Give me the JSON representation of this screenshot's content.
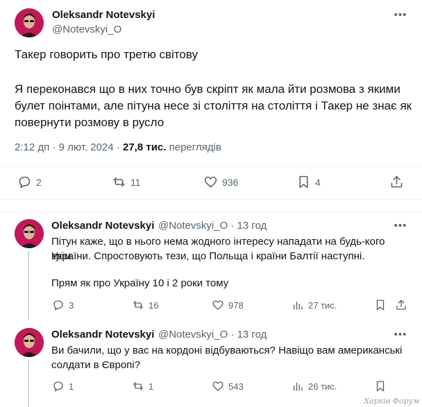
{
  "main_tweet": {
    "author_name": "Oleksandr Notevskyi",
    "author_handle": "@Notevskyi_O",
    "line1": "Такер говорить про третю світову",
    "para2_line1": "Я переконався що в них точно був скріпт як мала йти розмова з якими",
    "para2_line2": "булет поінтами, але пітуна несе зі століття на століття і Такер не знає як",
    "para2_line3": "повернути розмову в русло",
    "time": "2:12 дп · 9 лют. 2024 · ",
    "views_count": "27,8 тис.",
    "views_label": " переглядів",
    "replies": "2",
    "reposts": "11",
    "likes": "936",
    "bookmarks": "4"
  },
  "replies": [
    {
      "author_name": "Oleksandr Notevskyi",
      "author_handle": "@Notevskyi_O · 13 год",
      "line1": "Пітун каже, що в нього нема жодного інтересу нападати на будь-кого крім",
      "line2": "України. Спростовують тези, що Польща і країни Балтії наступні.",
      "line3": "Прям як про Україну 10 і 2 роки тому",
      "replies": "3",
      "reposts": "16",
      "likes": "978",
      "views": "27 тис."
    },
    {
      "author_name": "Oleksandr Notevskyi",
      "author_handle": "@Notevskyi_O · 13 год",
      "line1": "Ви бачили, що у вас на кордоні відбуваються? Навіщо вам американські",
      "line2": "солдати в Європі?",
      "replies": "1",
      "reposts": "1",
      "likes": "543",
      "views": "26 тис."
    }
  ],
  "watermark": "Харків Форум",
  "icons": {
    "reply": "reply-icon",
    "repost": "repost-icon",
    "like": "heart-icon",
    "bookmark": "bookmark-icon",
    "share": "share-icon",
    "views": "views-icon",
    "more": "more-icon"
  },
  "colors": {
    "text": "#0f1419",
    "secondary": "#536471",
    "divider": "#eff3f4"
  }
}
